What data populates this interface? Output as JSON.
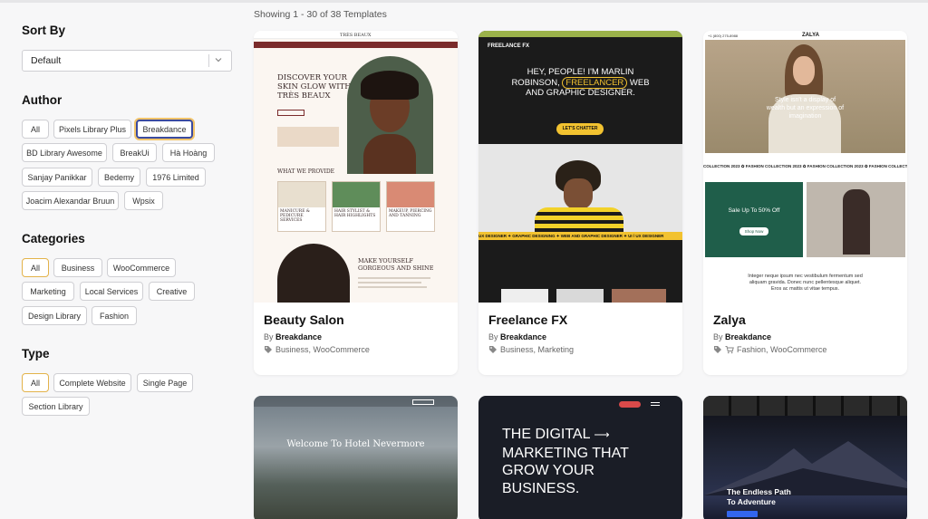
{
  "sidebar": {
    "sort_by": {
      "title": "Sort By",
      "value": "Default"
    },
    "author": {
      "title": "Author",
      "chips": [
        "All",
        "Pixels Library Plus",
        "Breakdance",
        "BD Library Awesome",
        "BreakUi",
        "Hà Hoàng",
        "Sanjay Panikkar",
        "Bedemy",
        "1976 Limited",
        "Joacim Alexandar Bruun",
        "Wpsix"
      ]
    },
    "categories": {
      "title": "Categories",
      "chips": [
        "All",
        "Business",
        "WooCommerce",
        "Marketing",
        "Local Services",
        "Creative",
        "Design Library",
        "Fashion"
      ]
    },
    "type": {
      "title": "Type",
      "chips": [
        "All",
        "Complete Website",
        "Single Page",
        "Section Library"
      ]
    }
  },
  "main": {
    "showing": "Showing 1 - 30 of 38 Templates",
    "by_prefix": "By",
    "cards": [
      {
        "title": "Beauty Salon",
        "author": "Breakdance",
        "cats": "Business, WooCommerce",
        "thumb": {
          "brand": "TRÈS BEAUX",
          "hero_line1": "DISCOVER YOUR",
          "hero_line2": "SKIN GLOW WITH",
          "hero_line3": "TRÈS BEAUX",
          "section": "WHAT WE PROVIDE",
          "svc1": "MANICURE & PEDICURE SERVICES",
          "svc2": "HAIR STYLIST & HAIR HIGHLIGHTS",
          "svc3": "MAKEUP, PIERCING AND TANNING",
          "mk1": "MAKE YOURSELF",
          "mk2": "GORGEOUS AND SHINE"
        }
      },
      {
        "title": "Freelance FX",
        "author": "Breakdance",
        "cats": "Business, Marketing",
        "thumb": {
          "brand": "FREELANCE FX",
          "h1": "HEY, PEOPLE! I'M MARLIN",
          "h2a": "ROBINSON,",
          "h2b": "FREELANCER",
          "h2c": "WEB",
          "h3": "AND GRAPHIC DESIGNER.",
          "cta": "LET'S CHATTER",
          "ticker": "UX DESIGNER ✦ GRAPHIC DESIGNING ✦ WEB AND GRAPHIC DESIGNER ✦ UI / UX DESIGNER"
        }
      },
      {
        "title": "Zalya",
        "author": "Breakdance",
        "cats": "Fashion, WooCommerce",
        "thumb": {
          "brand": "ZALYA",
          "phone": "+1 (800) 275-8988",
          "hero1": "Style isn't a display of",
          "hero2": "wealth but an expression of",
          "hero3": "imagination",
          "ticker": "COLLECTION 2023 ✿ FASHION COLLECTION 2023 ✿ FASHION COLLECTION 2023 ✿ FASHION COLLECTION 2",
          "sale": "Sale Up To 50% Off",
          "shop": "Shop Now",
          "body1": "Integer neque ipsum nec vestibulum fermentum sed",
          "body2": "aliquam gravida. Donec nunc pellentesque aliquet.",
          "body3": "Eros ac mattis ut vitae tempus."
        }
      },
      {
        "thumb": {
          "hero": "Welcome To Hotel Nevermore"
        }
      },
      {
        "thumb": {
          "l1": "THE DIGITAL",
          "l2": "MARKETING THAT",
          "l3": "GROW YOUR",
          "l4": "BUSINESS."
        }
      },
      {
        "thumb": {
          "l1": "The Endless Path",
          "l2": "To Adventure"
        }
      }
    ]
  },
  "colors": {
    "accent_yellow": "#f2c230",
    "zalya_green": "#1f5e4a",
    "selected_border": "#3a4aa0"
  }
}
